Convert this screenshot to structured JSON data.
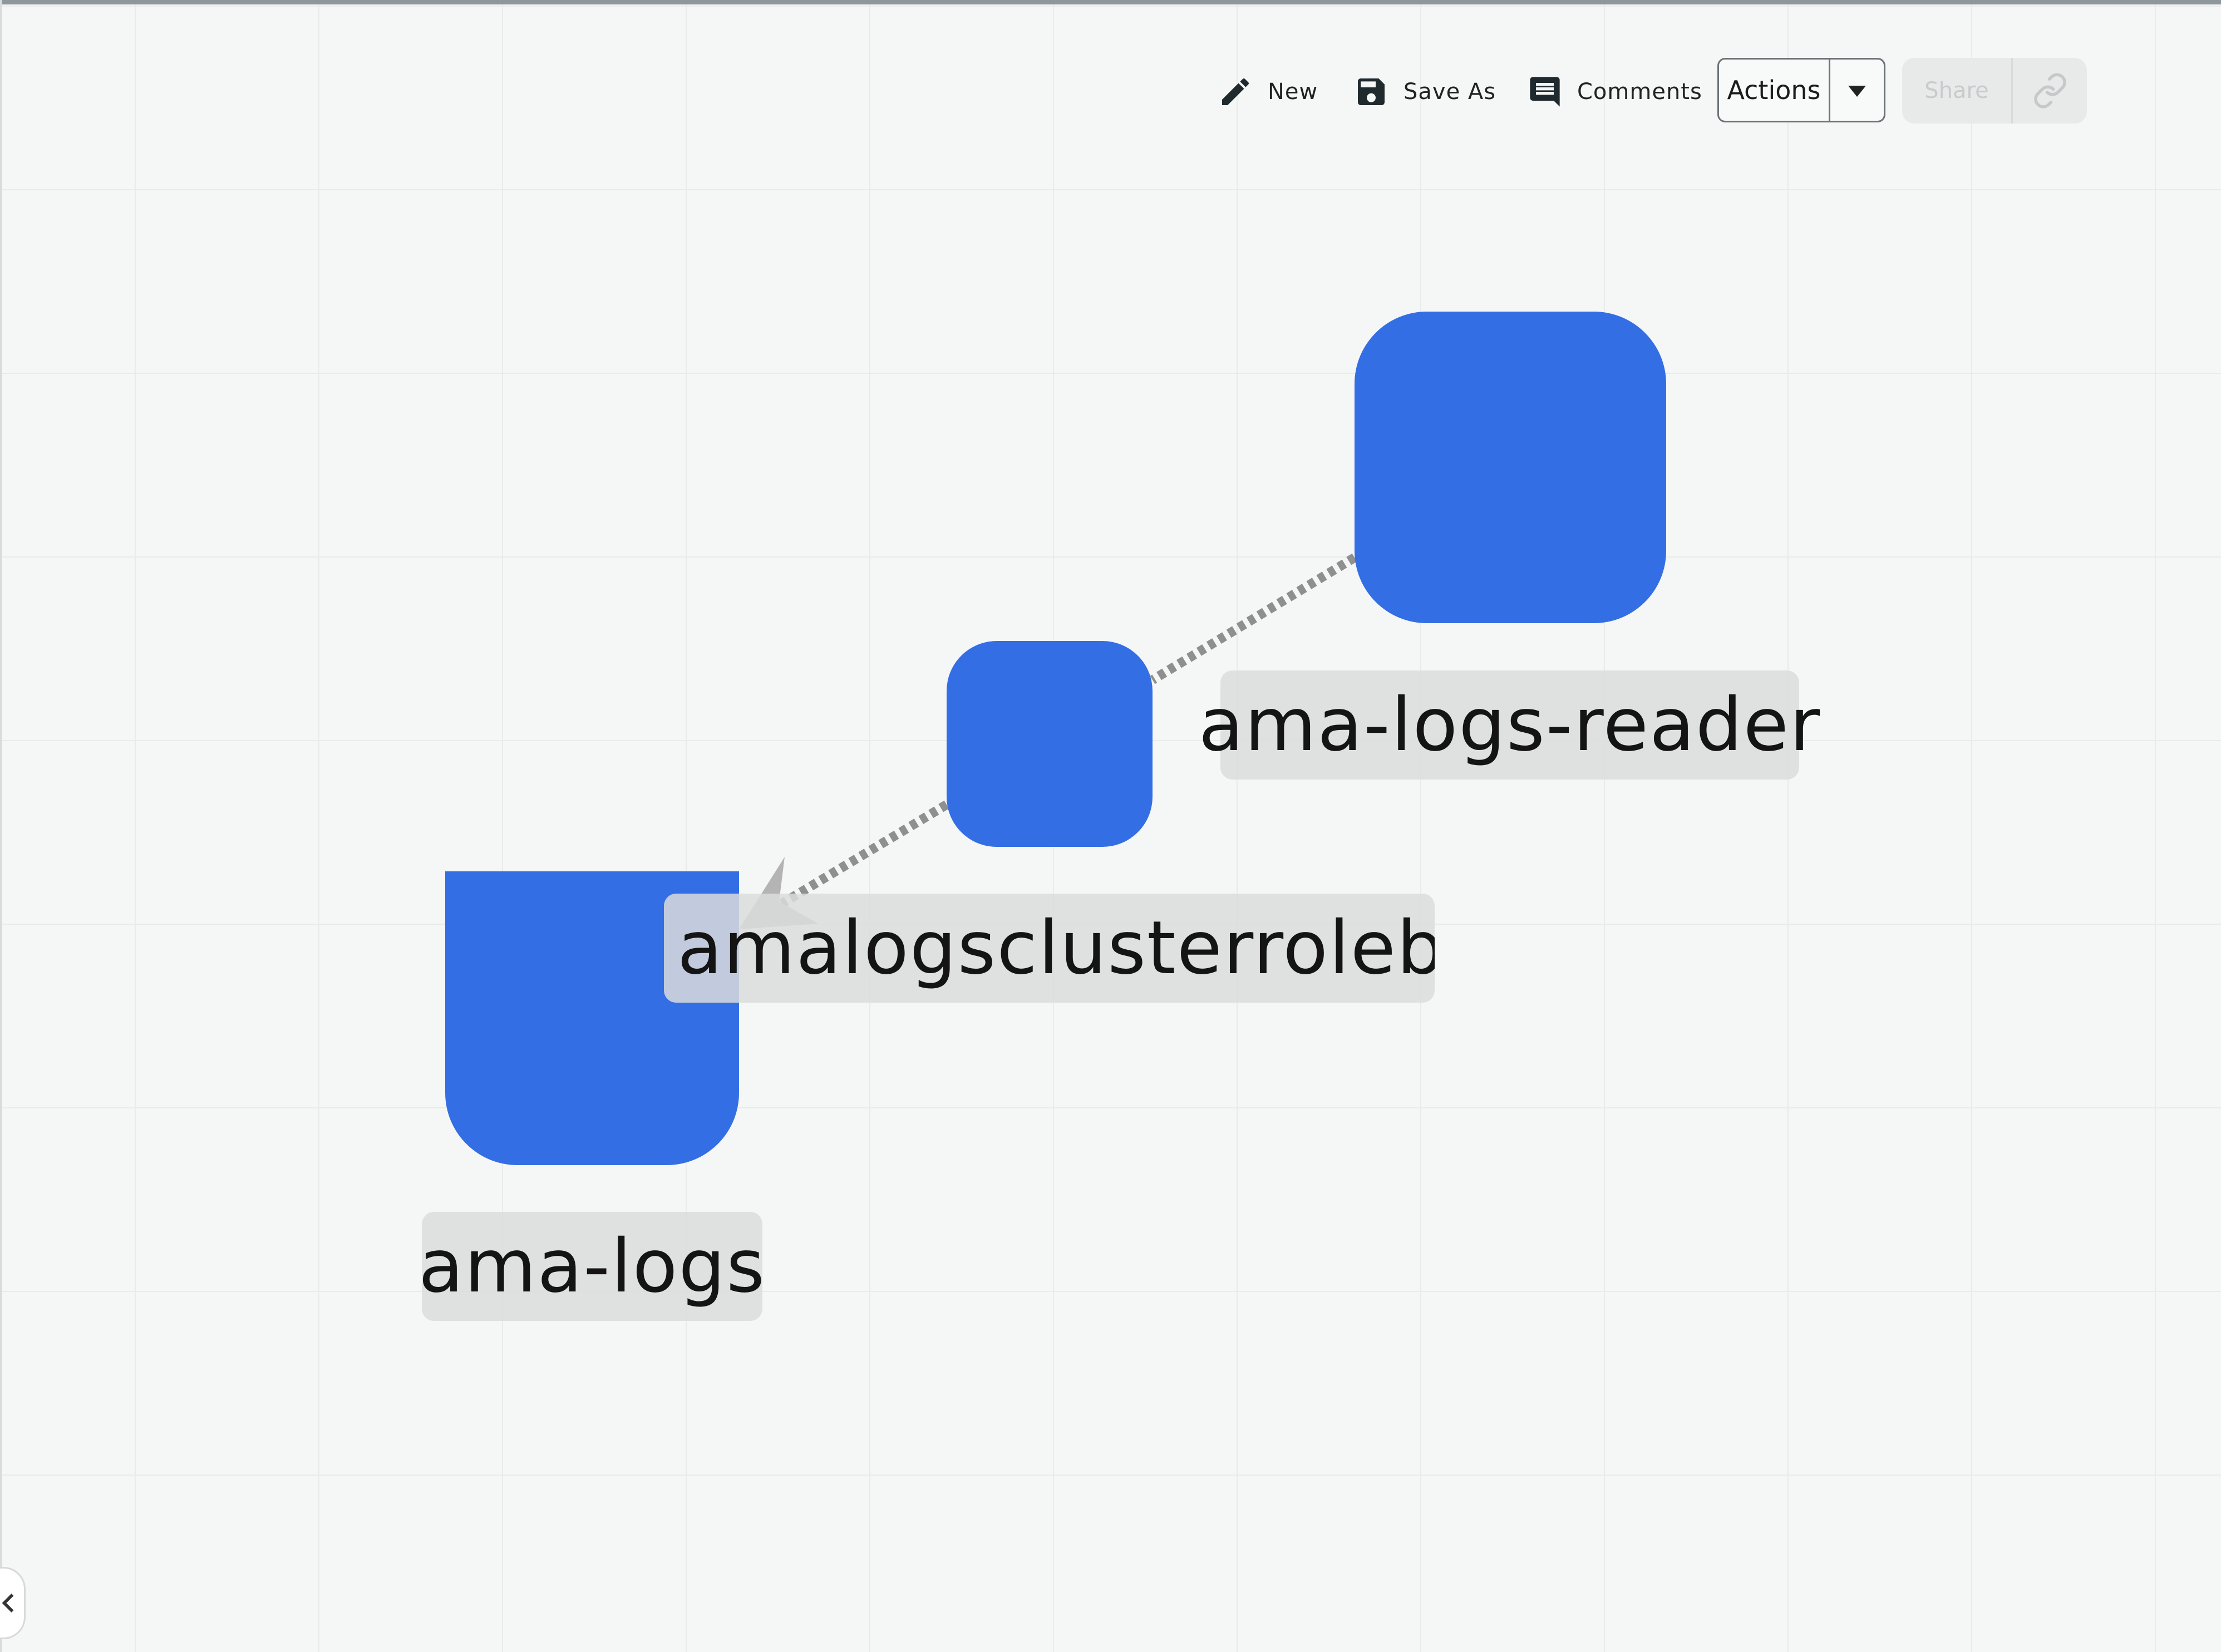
{
  "toolbar": {
    "new_label": "New",
    "new_icon": "pencil-icon",
    "save_as_label": "Save As",
    "save_as_icon": "floppy-disk-icon",
    "comments_label": "Comments",
    "comments_icon": "comment-icon",
    "actions_label": "Actions",
    "actions_icon": "caret-down-icon",
    "share_label": "Share",
    "share_link_icon": "link-icon",
    "share_enabled": false
  },
  "graph": {
    "nodes": [
      {
        "id": "ama-logs-reader",
        "label": "ama-logs-reader",
        "color": "#336ee4"
      },
      {
        "id": "amalogsclusterrolebinding",
        "label": "amalogsclusterroleb...",
        "color": "#336ee4"
      },
      {
        "id": "ama-logs",
        "label": "ama-logs",
        "color": "#336ee4"
      }
    ],
    "edges": [
      {
        "from": "ama-logs-reader",
        "to": "amalogsclusterrolebinding",
        "style": "dashed"
      },
      {
        "from": "amalogsclusterrolebinding",
        "to": "ama-logs",
        "style": "dashed",
        "arrow": true
      }
    ],
    "edge_color": "#8f8f8f"
  },
  "sidebar": {
    "collapse_icon": "chevron-left-icon"
  }
}
